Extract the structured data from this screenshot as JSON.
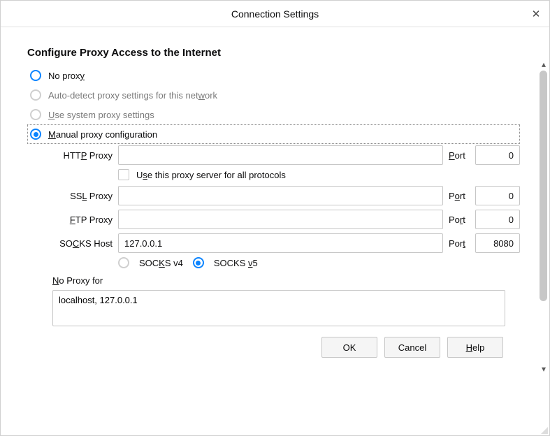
{
  "title": "Connection Settings",
  "section_heading": "Configure Proxy Access to the Internet",
  "options": {
    "no_proxy": "No prox",
    "no_proxy_ul": "y",
    "auto_detect_a": "Auto-detect proxy settings for this net",
    "auto_detect_ul": "w",
    "auto_detect_b": "ork",
    "system_ul": "U",
    "system_rest": "se system proxy settings",
    "manual_ul": "M",
    "manual_rest": "anual proxy configuration"
  },
  "fields": {
    "http_label_a": "HTT",
    "http_label_ul": "P",
    "http_label_b": " Proxy",
    "http_value": "",
    "http_port_label_a": "",
    "http_port_label_ul": "P",
    "http_port_label_b": "ort",
    "http_port": "0",
    "use_all_a": "U",
    "use_all_ul": "s",
    "use_all_b": "e this proxy server for all protocols",
    "ssl_label_a": "SS",
    "ssl_label_ul": "L",
    "ssl_label_b": " Proxy",
    "ssl_value": "",
    "ssl_port_label_a": "P",
    "ssl_port_label_ul": "o",
    "ssl_port_label_b": "rt",
    "ssl_port": "0",
    "ftp_label_ul": "F",
    "ftp_label_b": "TP Proxy",
    "ftp_value": "",
    "ftp_port_label_a": "Po",
    "ftp_port_label_ul": "r",
    "ftp_port_label_b": "t",
    "ftp_port": "0",
    "socks_label_a": "SO",
    "socks_label_ul": "C",
    "socks_label_b": "KS Host",
    "socks_value": "127.0.0.1",
    "socks_port_label_a": "Por",
    "socks_port_label_ul": "t",
    "socks_port": "8080",
    "socks4_a": "SOC",
    "socks4_ul": "K",
    "socks4_b": "S v4",
    "socks5_a": "SOCKS ",
    "socks5_ul": "v",
    "socks5_b": "5",
    "noproxy_label_ul": "N",
    "noproxy_label_b": "o Proxy for",
    "noproxy_value": "localhost, 127.0.0.1"
  },
  "buttons": {
    "ok": "OK",
    "cancel": "Cancel",
    "help_ul": "H",
    "help_b": "elp"
  }
}
